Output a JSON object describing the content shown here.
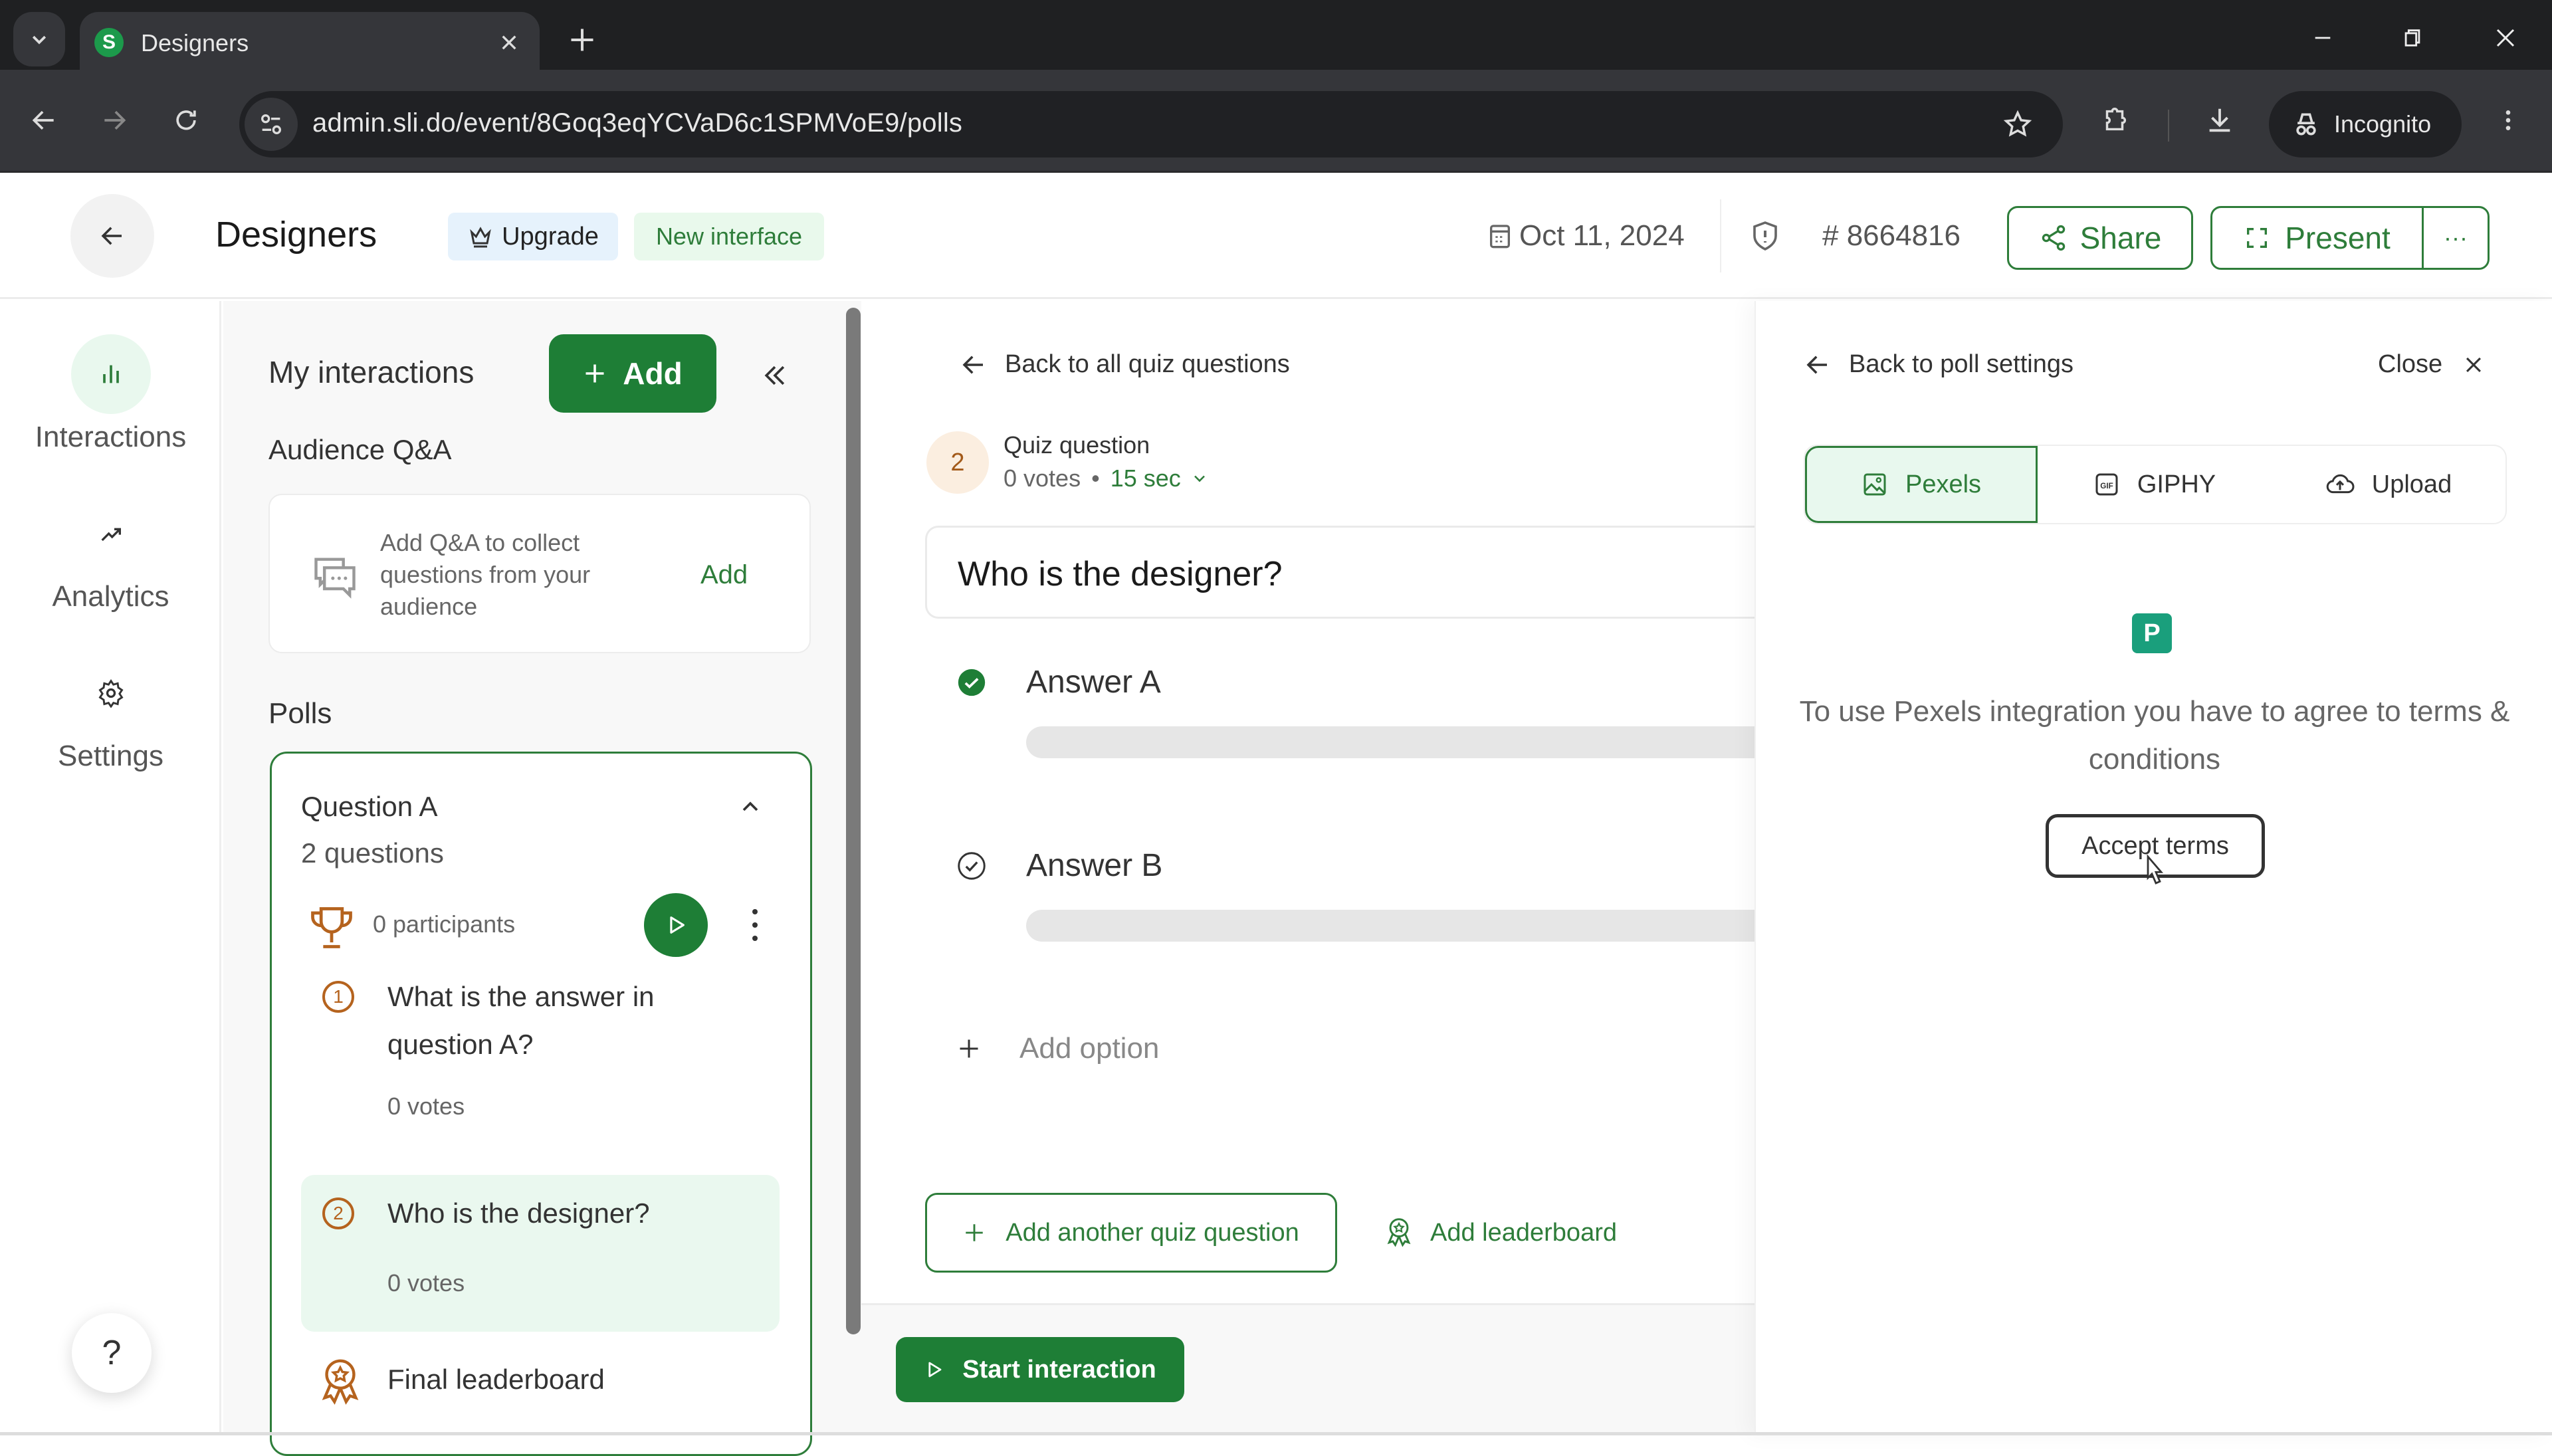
{
  "browser": {
    "tab_title": "Designers",
    "favicon_letter": "S",
    "url": "admin.sli.do/event/8Goq3eqYCVaD6c1SPMVoE9/polls",
    "profile_label": "Incognito"
  },
  "header": {
    "title": "Designers",
    "upgrade_label": "Upgrade",
    "new_interface_label": "New interface",
    "date": "Oct 11, 2024",
    "event_code": "# 8664816",
    "share_label": "Share",
    "present_label": "Present",
    "more_label": "···"
  },
  "left_nav": {
    "items": [
      {
        "label": "Interactions",
        "icon": "bar-chart-icon",
        "active": true
      },
      {
        "label": "Analytics",
        "icon": "trend-icon",
        "active": false
      },
      {
        "label": "Settings",
        "icon": "gear-icon",
        "active": false
      }
    ],
    "help_label": "?"
  },
  "interactions_panel": {
    "title": "My interactions",
    "add_label": "Add",
    "collapse_icon": "«",
    "qa_section_label": "Audience Q&A",
    "qa_card_text": "Add Q&A to collect questions from your audience",
    "qa_card_add": "Add",
    "polls_section_label": "Polls",
    "poll": {
      "title": "Question A",
      "question_count": "2 questions",
      "participants": "0 participants",
      "questions": [
        {
          "number": "1",
          "text": "What is the answer in question A?",
          "votes": "0 votes",
          "selected": false
        },
        {
          "number": "2",
          "text": "Who is the designer?",
          "votes": "0 votes",
          "selected": true
        }
      ],
      "final_leaderboard": "Final leaderboard"
    }
  },
  "editor": {
    "back_label": "Back to all quiz questions",
    "question_number": "2",
    "question_type": "Quiz question",
    "votes": "0 votes",
    "separator": "•",
    "timer": "15 sec",
    "question_text": "Who is the designer?",
    "answers": [
      {
        "label": "Answer A",
        "correct": true,
        "vote_fraction": 0
      },
      {
        "label": "Answer B",
        "correct": false,
        "vote_fraction": 0
      }
    ],
    "add_option_label": "Add option",
    "add_quiz_question_label": "Add another quiz question",
    "add_leaderboard_label": "Add leaderboard",
    "start_label": "Start interaction"
  },
  "media_panel": {
    "back_label": "Back to poll settings",
    "close_label": "Close",
    "tabs": [
      {
        "label": "Pexels",
        "icon": "image-icon",
        "active": true
      },
      {
        "label": "GIPHY",
        "icon": "gif-icon",
        "active": false
      },
      {
        "label": "Upload",
        "icon": "cloud-upload-icon",
        "active": false
      }
    ],
    "pexels_logo_letter": "P",
    "terms_text": "To use Pexels integration you have to agree to terms & conditions",
    "accept_label": "Accept terms"
  },
  "colors": {
    "brand_green": "#1e7e36",
    "accent_orange": "#b5631e",
    "pexels_teal": "#1a9f7c"
  }
}
